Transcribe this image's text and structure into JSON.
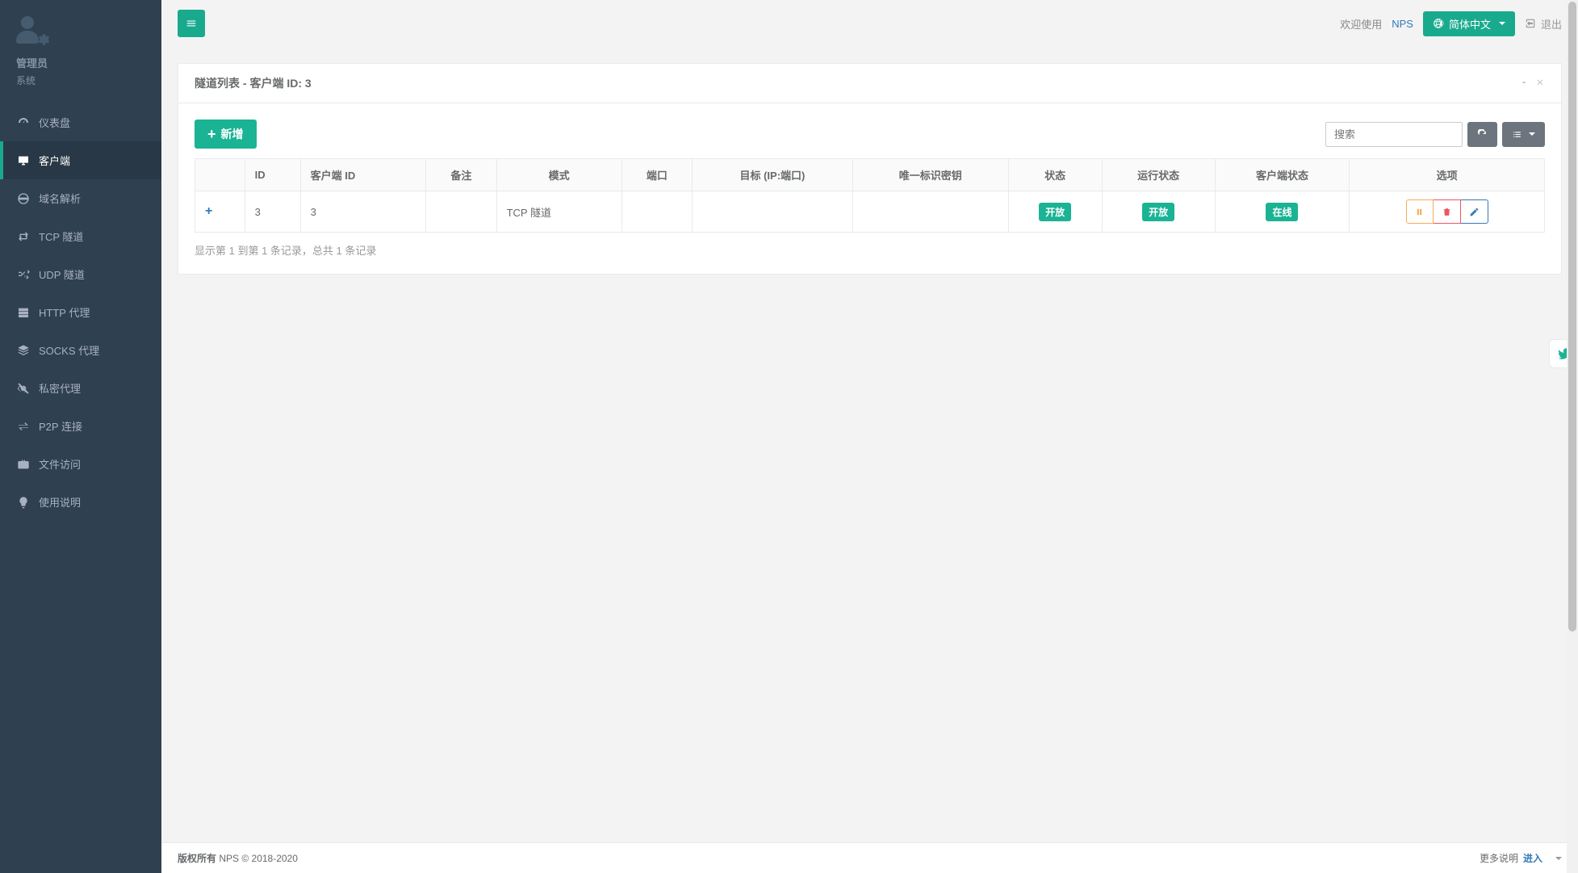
{
  "sidebar": {
    "admin_name": "管理员",
    "admin_role": "系统",
    "items": [
      {
        "label": "仪表盘",
        "icon": "dashboard"
      },
      {
        "label": "客户端",
        "icon": "desktop",
        "active": true
      },
      {
        "label": "域名解析",
        "icon": "globe"
      },
      {
        "label": "TCP 隧道",
        "icon": "retweet"
      },
      {
        "label": "UDP 隧道",
        "icon": "random"
      },
      {
        "label": "HTTP 代理",
        "icon": "server"
      },
      {
        "label": "SOCKS 代理",
        "icon": "layers"
      },
      {
        "label": "私密代理",
        "icon": "eye-slash"
      },
      {
        "label": "P2P 连接",
        "icon": "exchange"
      },
      {
        "label": "文件访问",
        "icon": "briefcase"
      },
      {
        "label": "使用说明",
        "icon": "bulb"
      }
    ]
  },
  "topbar": {
    "welcome": "欢迎使用",
    "brand": "NPS",
    "lang_label": "简体中文",
    "logout_label": "退出"
  },
  "panel": {
    "title": "隧道列表 - 客户端 ID: 3",
    "add_label": "新增",
    "search_placeholder": "搜索"
  },
  "table": {
    "columns": [
      "",
      "ID",
      "客户端 ID",
      "备注",
      "模式",
      "端口",
      "目标 (IP:端口)",
      "唯一标识密钥",
      "状态",
      "运行状态",
      "客户端状态",
      "选项"
    ],
    "rows": [
      {
        "id": "3",
        "client_id": "3",
        "remark": "",
        "mode": "TCP 隧道",
        "port": "",
        "target": "",
        "key": "",
        "status": "开放",
        "run_status": "开放",
        "client_status": "在线"
      }
    ],
    "info": "显示第 1 到第 1 条记录，总共 1 条记录"
  },
  "footer": {
    "copyright_strong": "版权所有",
    "copyright_rest": " NPS © 2018-2020",
    "more_text": "更多说明",
    "more_link": "进入"
  }
}
